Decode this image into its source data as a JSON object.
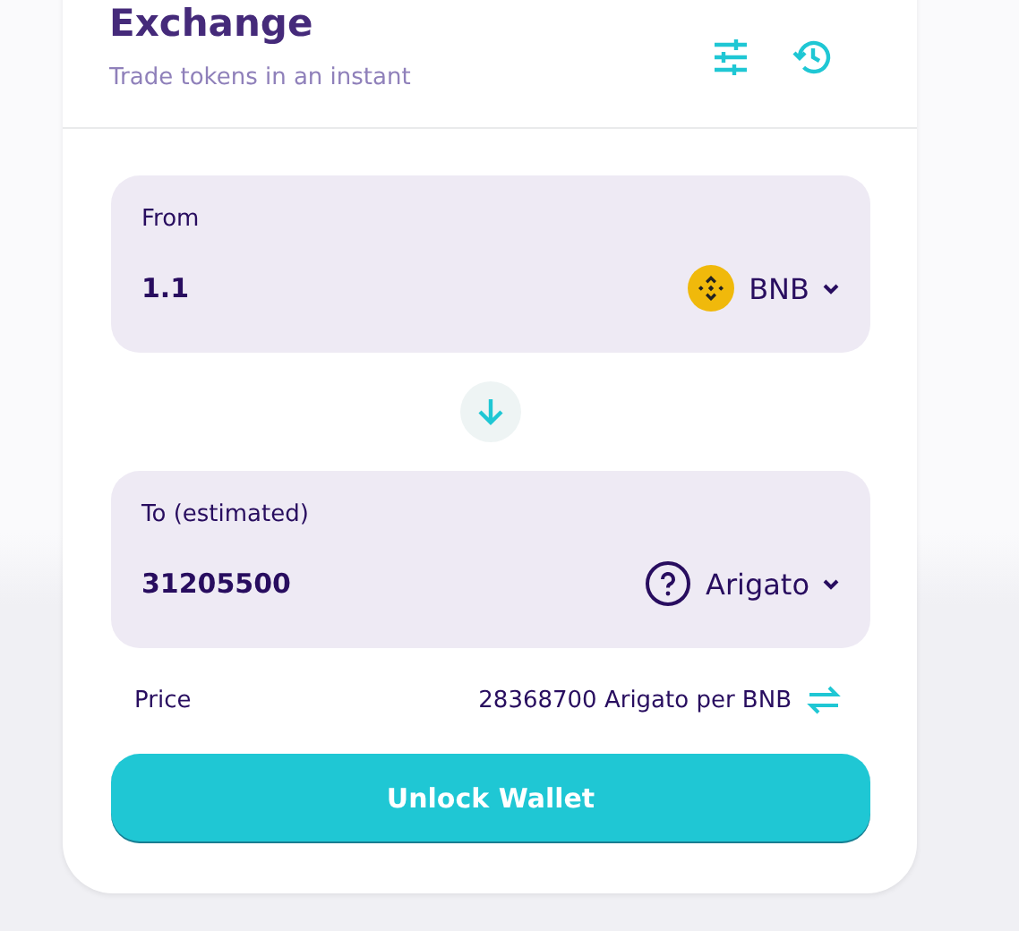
{
  "header": {
    "title": "Exchange",
    "subtitle": "Trade tokens in an instant"
  },
  "inputs": [
    {
      "label": "From",
      "value": "1.1",
      "token": {
        "kind": "coin",
        "symbol": "BNB"
      }
    },
    {
      "label": "To (estimated)",
      "value": "31205500",
      "token": {
        "kind": "unknown",
        "symbol": "Arigato"
      }
    }
  ],
  "price": {
    "label": "Price",
    "value": "28368700 Arigato per BNB"
  },
  "button": "Unlock Wallet"
}
